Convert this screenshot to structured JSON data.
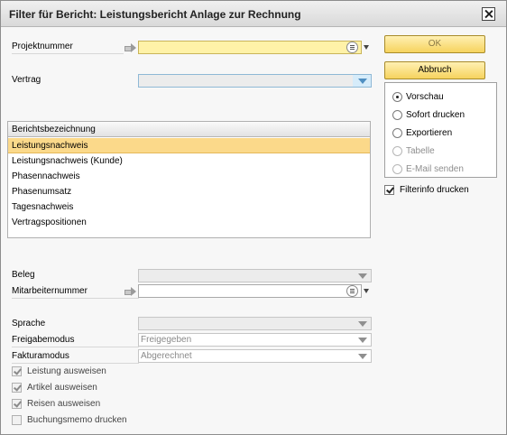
{
  "window": {
    "title": "Filter für Bericht: Leistungsbericht Anlage zur Rechnung"
  },
  "fields": {
    "projektnummer": {
      "label": "Projektnummer",
      "value": ""
    },
    "vertrag": {
      "label": "Vertrag",
      "value": ""
    },
    "beleg": {
      "label": "Beleg",
      "value": ""
    },
    "mitarbeiternummer": {
      "label": "Mitarbeiternummer",
      "value": ""
    },
    "sprache": {
      "label": "Sprache",
      "value": ""
    },
    "freigabemodus": {
      "label": "Freigabemodus",
      "value": "Freigegeben"
    },
    "fakturamodus": {
      "label": "Fakturamodus",
      "value": "Abgerechnet"
    }
  },
  "report_list": {
    "header": "Berichtsbezeichnung",
    "items": [
      {
        "label": "Leistungsnachweis",
        "selected": true
      },
      {
        "label": "Leistungsnachweis (Kunde)",
        "selected": false
      },
      {
        "label": "Phasennachweis",
        "selected": false
      },
      {
        "label": "Phasenumsatz",
        "selected": false
      },
      {
        "label": "Tagesnachweis",
        "selected": false
      },
      {
        "label": "Vertragspositionen",
        "selected": false
      }
    ]
  },
  "buttons": {
    "ok": "OK",
    "cancel": "Abbruch"
  },
  "output_options": [
    {
      "label": "Vorschau",
      "selected": true,
      "enabled": true
    },
    {
      "label": "Sofort drucken",
      "selected": false,
      "enabled": true
    },
    {
      "label": "Exportieren",
      "selected": false,
      "enabled": true
    },
    {
      "label": "Tabelle",
      "selected": false,
      "enabled": false
    },
    {
      "label": "E-Mail senden",
      "selected": false,
      "enabled": false
    }
  ],
  "filterinfo": {
    "label": "Filterinfo drucken",
    "checked": true
  },
  "checkboxes": [
    {
      "label": "Leistung ausweisen",
      "checked": true
    },
    {
      "label": "Artikel ausweisen",
      "checked": true
    },
    {
      "label": "Reisen ausweisen",
      "checked": true
    },
    {
      "label": "Buchungsmemo drucken",
      "checked": false
    }
  ],
  "colors": {
    "selection": "#fbd98a",
    "button": "#f6d35e",
    "active_input": "#fff2a8"
  }
}
